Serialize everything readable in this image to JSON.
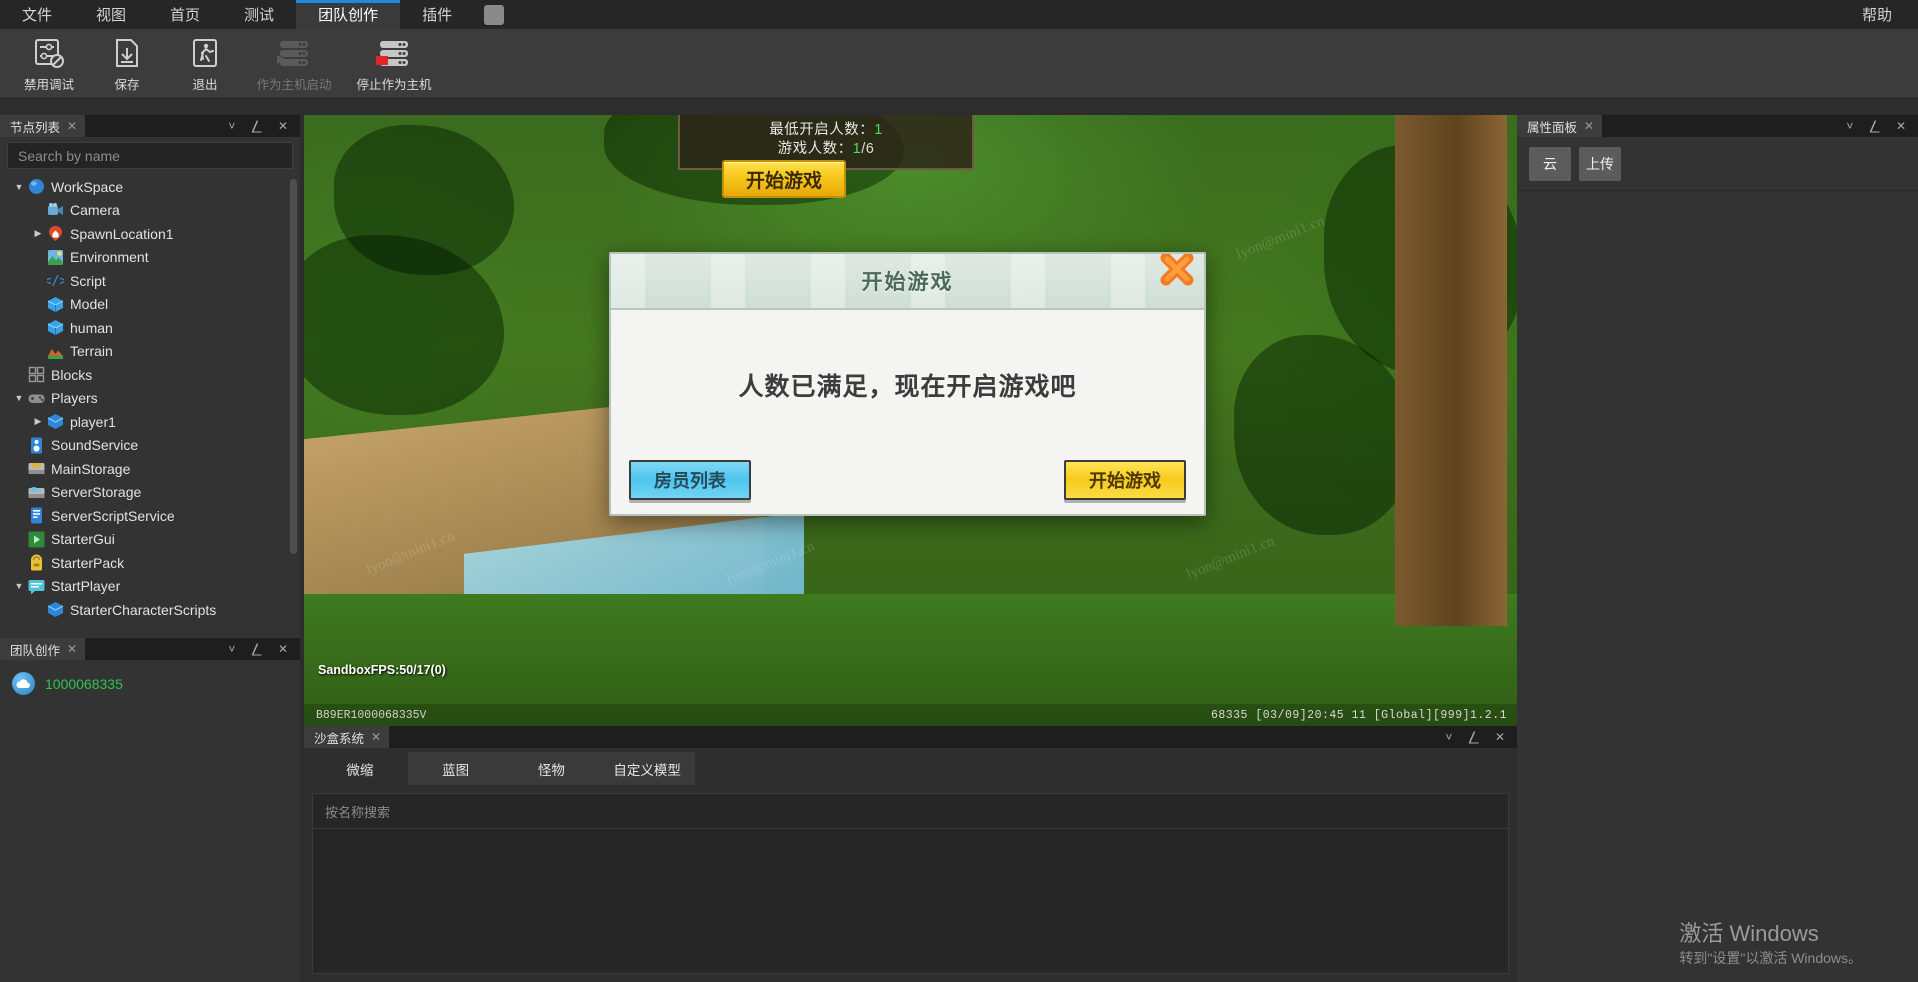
{
  "menubar": {
    "items": [
      {
        "label": "文件",
        "active": false
      },
      {
        "label": "视图",
        "active": false
      },
      {
        "label": "首页",
        "active": false
      },
      {
        "label": "测试",
        "active": false
      },
      {
        "label": "团队创作",
        "active": true
      },
      {
        "label": "插件",
        "active": false
      }
    ],
    "help_label": "帮助",
    "accent_color": "#1b8ae0"
  },
  "ribbon": {
    "buttons": [
      {
        "label": "禁用调试",
        "icon": "debug-disabled-icon",
        "disabled": false
      },
      {
        "label": "保存",
        "icon": "save-icon",
        "disabled": false
      },
      {
        "label": "退出",
        "icon": "exit-icon",
        "disabled": false
      },
      {
        "label": "作为主机启动",
        "icon": "host-start-icon",
        "disabled": true
      },
      {
        "label": "停止作为主机",
        "icon": "host-stop-icon",
        "disabled": false
      }
    ]
  },
  "nodelist": {
    "tab_title": "节点列表",
    "search_placeholder": "Search by name",
    "tree": [
      {
        "label": "WorkSpace",
        "depth": 0,
        "arrow": "down",
        "icon": "sphere-icon",
        "color": "#2f86d8"
      },
      {
        "label": "Camera",
        "depth": 1,
        "arrow": "none",
        "icon": "camera-icon",
        "color": "#5a9fd4"
      },
      {
        "label": "SpawnLocation1",
        "depth": 1,
        "arrow": "right",
        "icon": "spawn-pin-icon",
        "color": "#e04a2a"
      },
      {
        "label": "Environment",
        "depth": 1,
        "arrow": "none",
        "icon": "environment-icon",
        "color": "#3f9e4a"
      },
      {
        "label": "Script",
        "depth": 1,
        "arrow": "none",
        "icon": "script-icon",
        "color": "#3d8fd6"
      },
      {
        "label": "Model",
        "depth": 1,
        "arrow": "none",
        "icon": "model-cube-icon",
        "color": "#3aa0e8"
      },
      {
        "label": "human",
        "depth": 1,
        "arrow": "none",
        "icon": "model-cube-icon",
        "color": "#3aa0e8"
      },
      {
        "label": "Terrain",
        "depth": 1,
        "arrow": "none",
        "icon": "terrain-icon",
        "color": "#d4622a"
      },
      {
        "label": "Blocks",
        "depth": 0,
        "arrow": "none",
        "icon": "blocks-grid-icon",
        "color": "#9a9a9a"
      },
      {
        "label": "Players",
        "depth": 0,
        "arrow": "down",
        "icon": "gamepad-icon",
        "color": "#8e8e8e"
      },
      {
        "label": "player1",
        "depth": 1,
        "arrow": "right",
        "icon": "player-cube-icon",
        "color": "#2f86d8"
      },
      {
        "label": "SoundService",
        "depth": 0,
        "arrow": "none",
        "icon": "speaker-icon",
        "color": "#2f86d8"
      },
      {
        "label": "MainStorage",
        "depth": 0,
        "arrow": "none",
        "icon": "storage-icon",
        "color": "#d8b24a"
      },
      {
        "label": "ServerStorage",
        "depth": 0,
        "arrow": "none",
        "icon": "server-storage-icon",
        "color": "#6fc1e8"
      },
      {
        "label": "ServerScriptService",
        "depth": 0,
        "arrow": "none",
        "icon": "server-script-icon",
        "color": "#2f86d8"
      },
      {
        "label": "StarterGui",
        "depth": 0,
        "arrow": "none",
        "icon": "starter-gui-icon",
        "color": "#2f8a3a"
      },
      {
        "label": "StarterPack",
        "depth": 0,
        "arrow": "none",
        "icon": "backpack-icon",
        "color": "#e8c23a"
      },
      {
        "label": "StartPlayer",
        "depth": 0,
        "arrow": "down",
        "icon": "start-player-icon",
        "color": "#4fc3d8"
      },
      {
        "label": "StarterCharacterScripts",
        "depth": 1,
        "arrow": "none",
        "icon": "player-cube-icon",
        "color": "#2f86d8"
      }
    ]
  },
  "teampanel": {
    "tab_title": "团队创作",
    "member_id": "1000068335",
    "member_id_color": "#2fc44e"
  },
  "viewport": {
    "hud": {
      "min_players_label": "最低开启人数：",
      "min_players_value": "1",
      "game_players_label": "游戏人数：",
      "game_players_value": "1",
      "game_players_max": "/6",
      "start_button": "开始游戏",
      "value_color": "#4ddc5e"
    },
    "fps_text": "SandboxFPS:50/17(0)",
    "status_left": "B89ER1000068335V",
    "status_right": "68335   [03/09]20:45 11 [Global][999]1.2.1",
    "watermarks": [
      "lyon@mini1.cn",
      "lyon@mini1.cn",
      "lyon@mini1.cn",
      "lyon@mini1.cn",
      "lyon@mini1.cn",
      "lyon@mini1.cn"
    ]
  },
  "dialog": {
    "title": "开始游戏",
    "message": "人数已满足，现在开启游戏吧",
    "close_icon": "close-x-icon",
    "buttons": [
      {
        "label": "房员列表",
        "style": "blue",
        "color": "#4fc5ef"
      },
      {
        "label": "开始游戏",
        "style": "yellow",
        "color": "#f7cb1c"
      }
    ]
  },
  "sandbox": {
    "tab_title": "沙盒系统",
    "tabs": [
      {
        "label": "微缩",
        "active": true
      },
      {
        "label": "蓝图",
        "active": false
      },
      {
        "label": "怪物",
        "active": false
      },
      {
        "label": "自定义模型",
        "active": false
      }
    ],
    "search_placeholder": "按名称搜索",
    "add_icon": "add-model-icon"
  },
  "properties": {
    "tab_title": "属性面板",
    "buttons": [
      {
        "label": "云"
      },
      {
        "label": "上传"
      }
    ]
  },
  "windows_watermark": {
    "line1": "激活 Windows",
    "line2": "转到\"设置\"以激活 Windows。"
  }
}
